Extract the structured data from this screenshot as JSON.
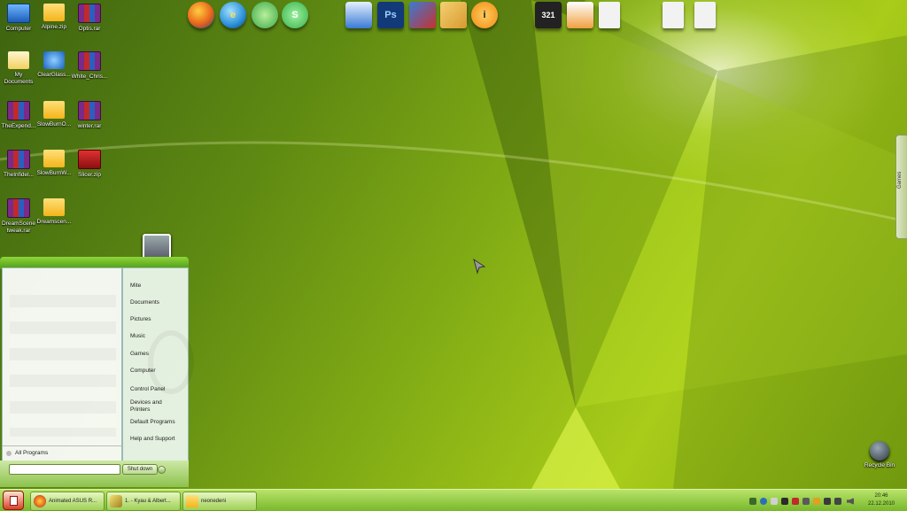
{
  "desktop_icons": [
    {
      "label": "Computer",
      "icon": "computer-icon"
    },
    {
      "label": "Alpine.zip",
      "icon": "folder-icon"
    },
    {
      "label": "Optis.rar",
      "icon": "rar-icon"
    },
    {
      "label": "My\nDocuments",
      "icon": "documents-icon"
    },
    {
      "label": "ClearGlass...",
      "icon": "cursor-icon"
    },
    {
      "label": "White_Chris...",
      "icon": "rar-icon"
    },
    {
      "label": "TheExpend...",
      "icon": "rar-icon"
    },
    {
      "label": "SlowBurnO...",
      "icon": "folder-icon"
    },
    {
      "label": "winter.rar",
      "icon": "rar-icon"
    },
    {
      "label": "TheInfidel...",
      "icon": "rar-icon"
    },
    {
      "label": "SlowBurnW...",
      "icon": "folder-icon"
    },
    {
      "label": "Slicer.zip",
      "icon": "slicer-icon"
    },
    {
      "label": "DreamScene\ntweak.rar",
      "icon": "rar-icon"
    },
    {
      "label": "Dreamscen...",
      "icon": "folder-icon"
    }
  ],
  "dock": {
    "group1": [
      {
        "icon": "firefox-icon",
        "color": "#e8651a"
      },
      {
        "icon": "internet-explorer-icon",
        "color": "#2b8fd8"
      },
      {
        "icon": "messenger-icon",
        "color": "#3aa84a"
      },
      {
        "icon": "skype-icon",
        "color": "#37b24a",
        "glyph": "S"
      }
    ],
    "group2": [
      {
        "icon": "network-icon",
        "color": "#3a7bd5"
      },
      {
        "icon": "photoshop-icon",
        "color": "#123a78",
        "glyph": "Ps"
      },
      {
        "icon": "image-editor-icon",
        "color": "#c83030"
      },
      {
        "icon": "paint-icon",
        "color": "#d89a30"
      },
      {
        "icon": "info-icon",
        "color": "#f08a10",
        "glyph": "i"
      }
    ],
    "group3": [
      {
        "icon": "media-player-classic-icon",
        "color": "#222222",
        "glyph": "321"
      },
      {
        "icon": "media-player-icon",
        "color": "#f0a040"
      },
      {
        "icon": "document-icon",
        "color": "#f2f2f2"
      }
    ],
    "group4": [
      {
        "icon": "document-icon",
        "color": "#f2f2f2"
      },
      {
        "icon": "document-icon",
        "color": "#f2f2f2"
      }
    ]
  },
  "start_menu": {
    "right_items": [
      "Mite",
      "Documents",
      "Pictures",
      "Music",
      "Games",
      "Computer",
      "Control Panel",
      "Devices and\nPrinters",
      "Default Programs",
      "Help and Support"
    ],
    "all_programs": "All Programs",
    "search_placeholder": "",
    "shutdown_label": "Shut down"
  },
  "side_gadget": {
    "label": "Games"
  },
  "recycle_bin": {
    "label": "Recycle Bin"
  },
  "taskbar": {
    "buttons": [
      {
        "label": "Animated ASUS R...",
        "icon": "firefox-icon"
      },
      {
        "label": "1. - Kyau & Albert...",
        "icon": "winamp-icon"
      },
      {
        "label": "neonedeni",
        "icon": "folder-icon"
      }
    ],
    "clock_time": "20:46",
    "clock_date": "22.12.2010"
  },
  "colors": {
    "accent": "#8ed63a",
    "taskbar": "#9fd055"
  }
}
